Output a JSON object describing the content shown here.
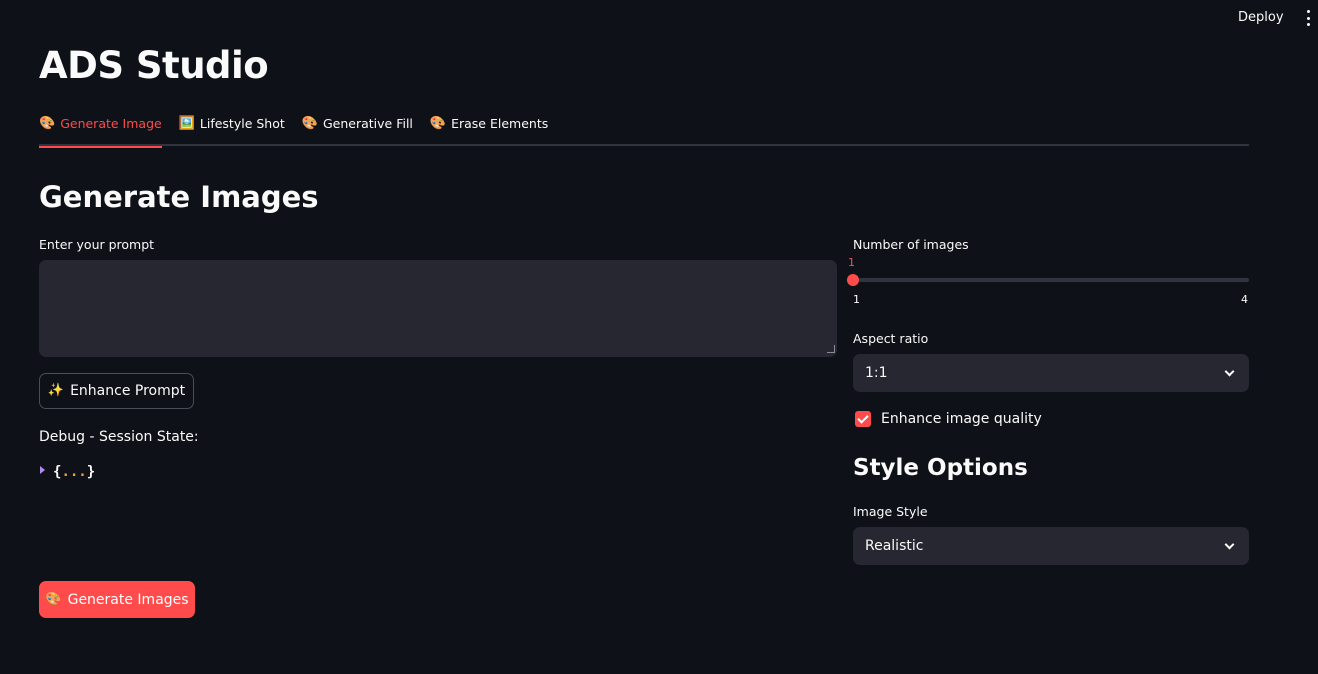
{
  "topbar": {
    "deploy_label": "Deploy",
    "menu_icon": "kebab-menu-icon"
  },
  "app": {
    "title": "ADS Studio"
  },
  "tabs": [
    {
      "label": "Generate Image",
      "icon": "palette-icon",
      "glyph": "🎨",
      "active": true
    },
    {
      "label": "Lifestyle Shot",
      "icon": "picture-icon",
      "glyph": "🖼️",
      "active": false
    },
    {
      "label": "Generative Fill",
      "icon": "palette-icon",
      "glyph": "🎨",
      "active": false
    },
    {
      "label": "Erase Elements",
      "icon": "palette-icon",
      "glyph": "🎨",
      "active": false
    }
  ],
  "main": {
    "section_title": "Generate Images",
    "prompt_label": "Enter your prompt",
    "prompt_value": "",
    "enhance_button": {
      "label": "Enhance Prompt",
      "icon": "sparkles-icon",
      "glyph": "✨"
    },
    "debug_label": "Debug - Session State:",
    "session_state": {
      "open": "{",
      "dots": "...",
      "close": "}"
    },
    "generate_button": {
      "label": "Generate Images",
      "icon": "palette-icon",
      "glyph": "🎨"
    }
  },
  "settings": {
    "num_images": {
      "label": "Number of images",
      "value": 1,
      "min": 1,
      "max": 4,
      "value_text": "1",
      "min_text": "1",
      "max_text": "4"
    },
    "aspect_ratio": {
      "label": "Aspect ratio",
      "value": "1:1"
    },
    "enhance_quality": {
      "label": "Enhance image quality",
      "checked": true
    },
    "style_heading": "Style Options",
    "image_style": {
      "label": "Image Style",
      "value": "Realistic"
    }
  },
  "colors": {
    "accent": "#ff4b4b",
    "background": "#0e1117",
    "input_bg": "#262730"
  }
}
